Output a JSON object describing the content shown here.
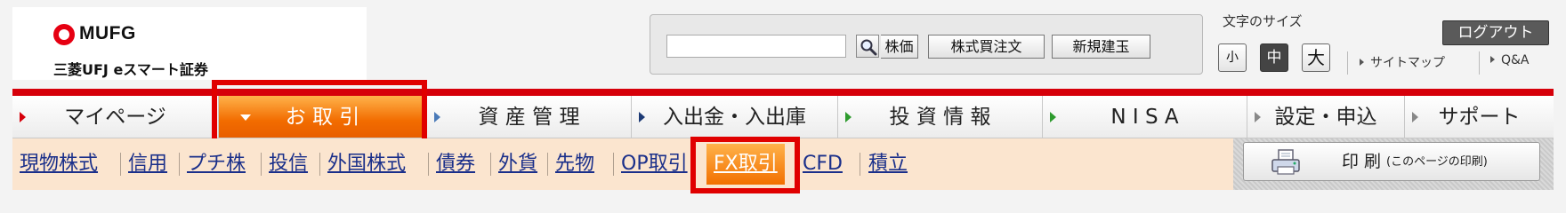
{
  "brand": {
    "logo_text": "MUFG",
    "company": "三菱UFJ eスマート証券"
  },
  "search": {
    "value": "",
    "buttons": [
      "株価",
      "株式買注文",
      "新規建玉"
    ]
  },
  "font_size": {
    "label": "文字のサイズ",
    "options": [
      "小",
      "中",
      "大"
    ],
    "selected": "中"
  },
  "utility": {
    "logout": "ログアウト",
    "sitemap": "サイトマップ",
    "qa": "Q&A"
  },
  "main_nav": {
    "items": [
      {
        "label": "マイページ",
        "arrow": "red"
      },
      {
        "label": "お 取 引",
        "arrow": "white",
        "active": true
      },
      {
        "label": "資 産 管 理",
        "arrow": "blue"
      },
      {
        "label": "入出金・入出庫",
        "arrow": "navy"
      },
      {
        "label": "投 資 情 報",
        "arrow": "green"
      },
      {
        "label": "N I S A",
        "arrow": "green"
      },
      {
        "label": "設定・申込",
        "arrow": "grey"
      },
      {
        "label": "サポート",
        "arrow": "grey"
      }
    ]
  },
  "sub_nav": {
    "items": [
      "現物株式",
      "信用",
      "プチ株",
      "投信",
      "外国株式",
      "債券",
      "外貨",
      "先物",
      "OP取引",
      "FX取引",
      "CFD",
      "積立"
    ],
    "active": "FX取引"
  },
  "print": {
    "label": "印 刷",
    "note": "(このページの印刷)"
  },
  "colors": {
    "accent_red": "#d6000a",
    "active_orange": "#f26c00",
    "sub_bg": "#fbe5cf",
    "link_blue": "#1a2f8a"
  }
}
